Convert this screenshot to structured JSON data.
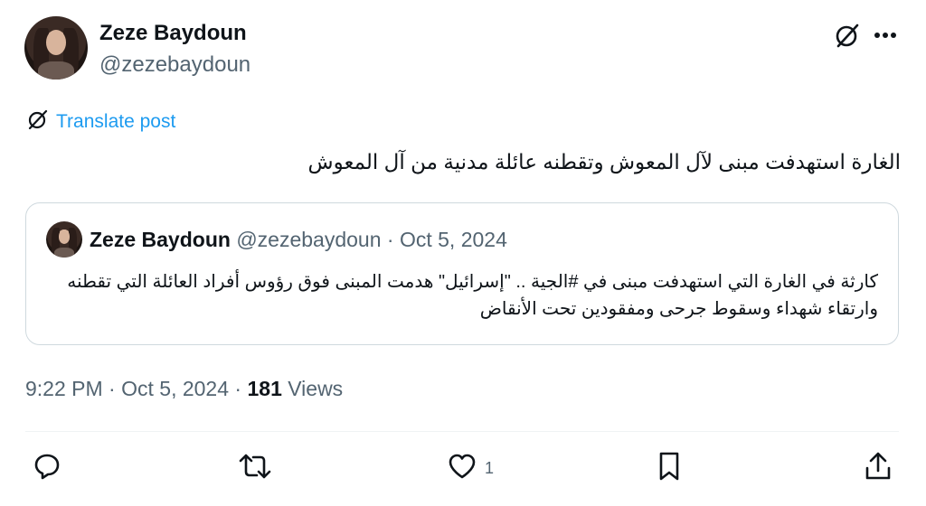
{
  "author": {
    "display_name": "Zeze Baydoun",
    "handle": "@zezebaydoun"
  },
  "translate_label": "Translate post",
  "tweet_text": "الغارة استهدفت  مبنى لآل المعوش وتقطنه عائلة مدنية من آل المعوش",
  "quote": {
    "display_name": "Zeze Baydoun",
    "handle": "@zezebaydoun",
    "separator": "·",
    "date": "Oct 5, 2024",
    "text": "كارثة في الغارة التي استهدفت مبنى في #الجية .. \"إسرائيل\" هدمت المبنى فوق رؤوس أفراد العائلة التي تقطنه وارتقاء شهداء وسقوط جرحى ومفقودين تحت الأنقاض"
  },
  "meta": {
    "time": "9:22 PM",
    "separator": "·",
    "date": "Oct 5, 2024",
    "views_count": "181",
    "views_label": "Views"
  },
  "actions": {
    "like_count": "1"
  },
  "icons": {
    "grok": "grok-icon",
    "more": "more-icon",
    "reply": "reply-icon",
    "retweet": "retweet-icon",
    "like": "heart-icon",
    "bookmark": "bookmark-icon",
    "share": "share-icon"
  },
  "colors": {
    "link": "#1d9bf0",
    "muted": "#536471",
    "text": "#0f1419",
    "border": "#cfd9de"
  }
}
